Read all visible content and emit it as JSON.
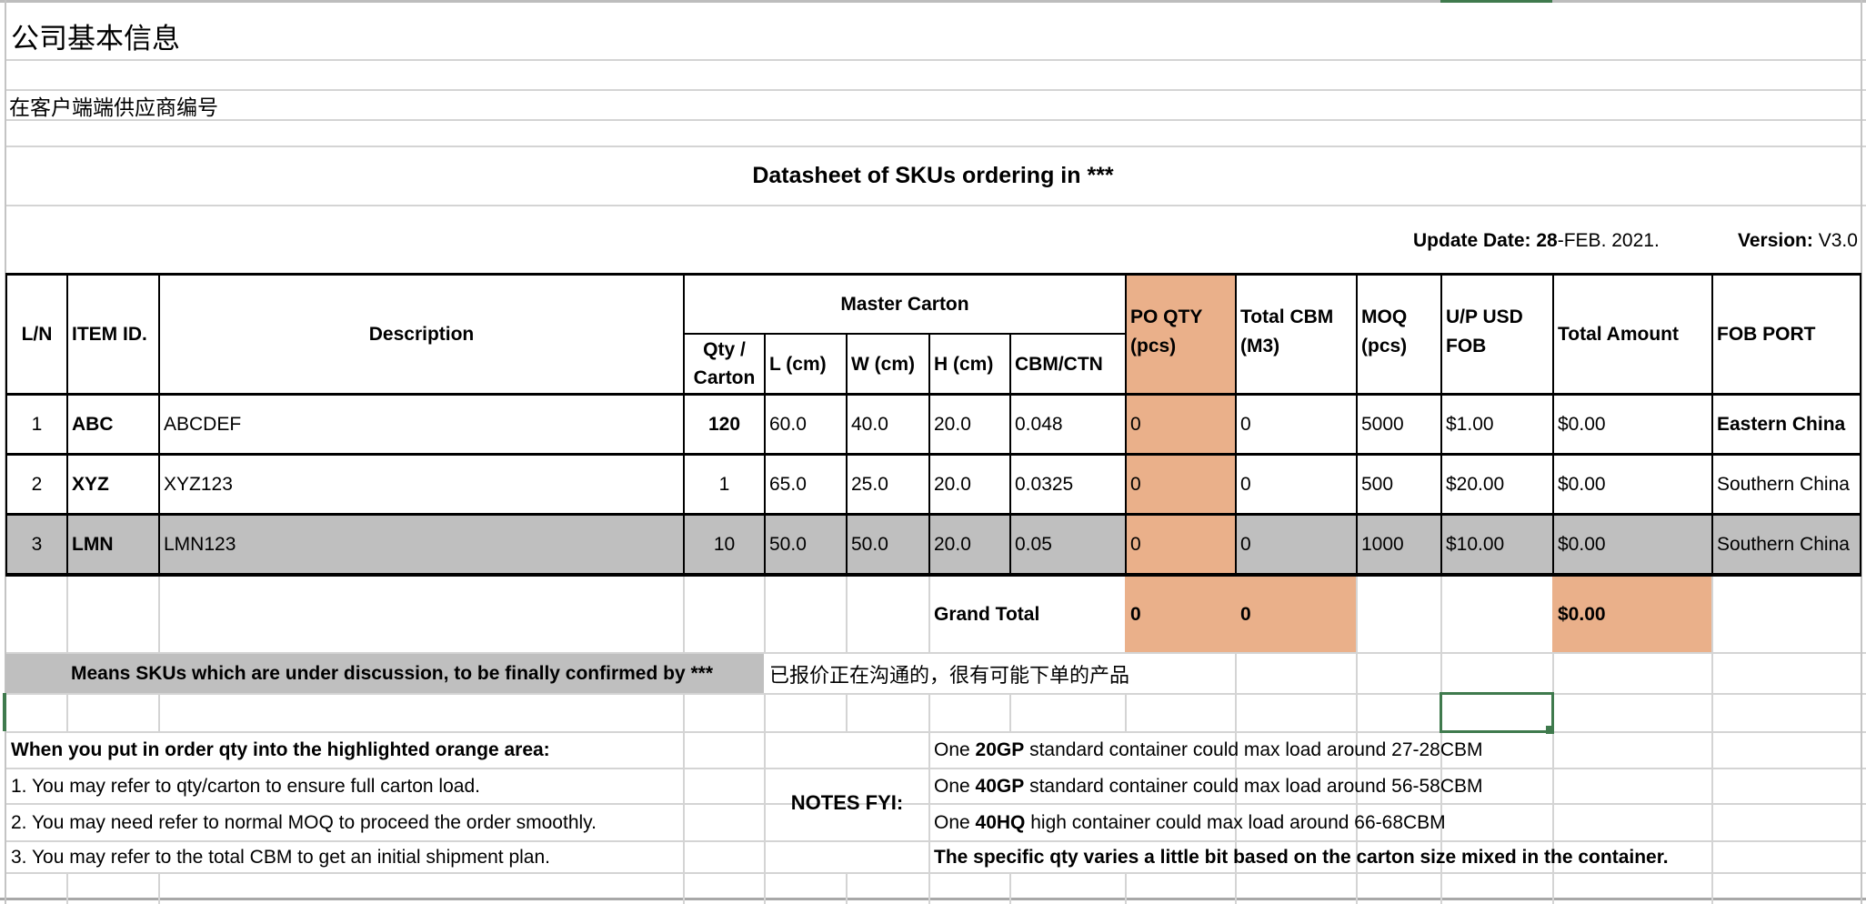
{
  "sheet": {
    "company_info_label": "公司基本信息",
    "supplier_code_label": "在客户端端供应商编号",
    "title": "Datasheet of SKUs ordering in ***",
    "update_date_label": "Update Date:",
    "update_date_day": "28",
    "update_date_rest": "-FEB. 2021.",
    "version_label": "Version:",
    "version_value": "V3.0"
  },
  "colors": {
    "po_highlight": "#EAB08A",
    "under_discussion": "#BFBFBF",
    "selection": "#3F7A4D"
  },
  "table": {
    "headers": {
      "ln": "L/N",
      "item_id": "ITEM ID.",
      "description": "Description",
      "master_carton": "Master Carton",
      "qty_carton": "Qty / Carton",
      "l_cm": "L (cm)",
      "w_cm": "W (cm)",
      "h_cm": "H (cm)",
      "cbm_ctn": "CBM/CTN",
      "po_qty": "PO QTY (pcs)",
      "total_cbm": "Total CBM (M3)",
      "moq": "MOQ (pcs)",
      "up_usd": "U/P USD FOB",
      "total_amount": "Total Amount",
      "fob_port": "FOB PORT"
    },
    "rows": [
      {
        "ln": "1",
        "item_id": "ABC",
        "description": "ABCDEF",
        "qty_carton": "120",
        "l": "60.0",
        "w": "40.0",
        "h": "20.0",
        "cbm_ctn": "0.048",
        "po_qty": "0",
        "total_cbm": "0",
        "moq": "5000",
        "unit_price": "$1.00",
        "total_amount": "$0.00",
        "fob_port": "Eastern China"
      },
      {
        "ln": "2",
        "item_id": "XYZ",
        "description": "XYZ123",
        "qty_carton": "1",
        "l": "65.0",
        "w": "25.0",
        "h": "20.0",
        "cbm_ctn": "0.0325",
        "po_qty": "0",
        "total_cbm": "0",
        "moq": "500",
        "unit_price": "$20.00",
        "total_amount": "$0.00",
        "fob_port": "Southern China"
      },
      {
        "ln": "3",
        "item_id": "LMN",
        "description": "LMN123",
        "qty_carton": "10",
        "l": "50.0",
        "w": "50.0",
        "h": "20.0",
        "cbm_ctn": "0.05",
        "po_qty": "0",
        "total_cbm": "0",
        "moq": "1000",
        "unit_price": "$10.00",
        "total_amount": "$0.00",
        "fob_port": "Southern China"
      }
    ],
    "grand_total": {
      "label": "Grand Total",
      "po_qty": "0",
      "total_cbm": "0",
      "total_amount": "$0.00"
    }
  },
  "legend": {
    "english": "Means SKUs which are under discussion,  to be finally confirmed by ***",
    "chinese": "已报价正在沟通的，很有可能下单的产品"
  },
  "instructions": {
    "heading": "When you put in order qty into the highlighted orange area:",
    "items": [
      "1. You may refer to qty/carton to ensure full carton load.",
      "2. You may need refer to normal MOQ to proceed the order smoothly.",
      "3. You may refer to the total CBM to get an initial shipment plan."
    ]
  },
  "notes": {
    "label": "NOTES FYI:",
    "containers": [
      {
        "prefix": "One ",
        "type": "20GP",
        "suffix": " standard container could max load around 27-28CBM"
      },
      {
        "prefix": "One ",
        "type": "40GP",
        "suffix": " standard container could max load around 56-58CBM"
      },
      {
        "prefix": "One ",
        "type": "40HQ",
        "suffix": " high container could max load around 66-68CBM"
      }
    ],
    "footnote": "The specific qty varies a little bit based on the carton size mixed in the container."
  }
}
